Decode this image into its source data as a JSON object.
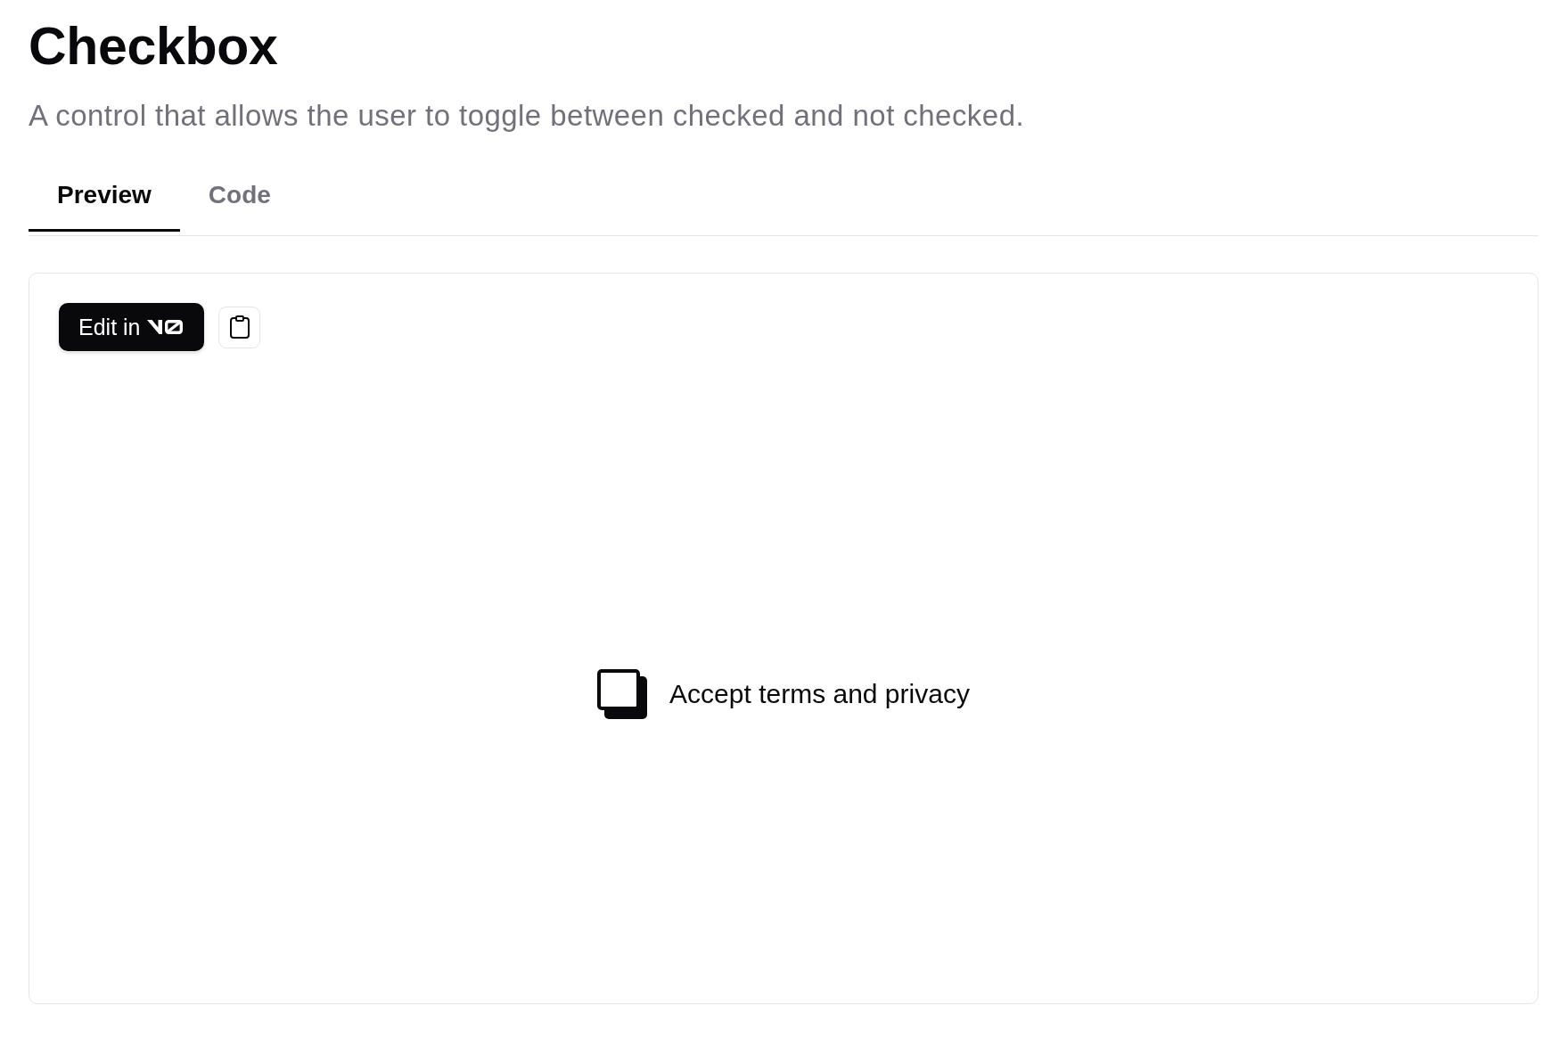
{
  "header": {
    "title": "Checkbox",
    "description": "A control that allows the user to toggle between checked and not checked."
  },
  "tabs": [
    {
      "label": "Preview",
      "selected": true
    },
    {
      "label": "Code",
      "selected": false
    }
  ],
  "preview": {
    "edit_button": {
      "label": "Edit in"
    },
    "checkbox": {
      "label": "Accept terms and privacy",
      "checked": false
    }
  }
}
